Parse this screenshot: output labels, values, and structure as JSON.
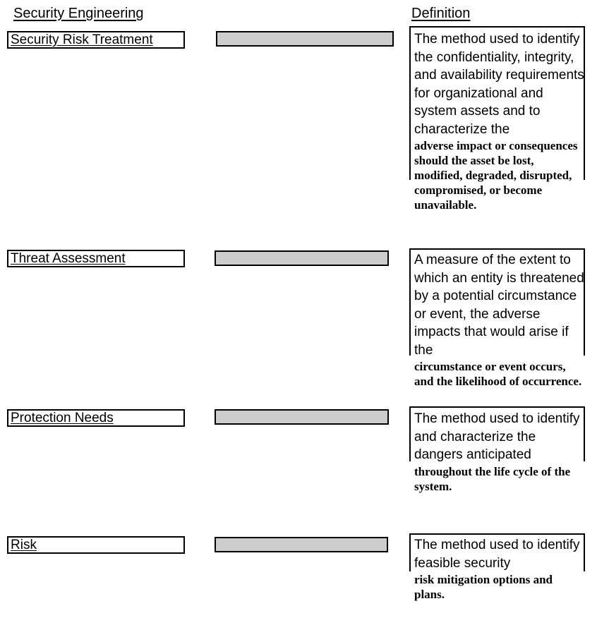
{
  "headers": {
    "left": "Security Engineering",
    "right": "Definition"
  },
  "rows": [
    {
      "term": "Security Risk Treatment",
      "definition_primary": "The method used to identify the confidentiality, integrity, and availability requirements for organizational and system assets and to characterize the",
      "definition_secondary": "adverse impact or consequences should the asset be lost, modified, degraded, disrupted, compromised, or become unavailable."
    },
    {
      "term": "Threat Assessment",
      "definition_primary": "A measure of the extent to which an entity is threatened by a potential circumstance or event, the adverse impacts that would arise if the",
      "definition_secondary": "circumstance or event occurs, and the likelihood of occurrence."
    },
    {
      "term": "Protection Needs",
      "definition_primary": "The method used to identify and characterize the dangers anticipated",
      "definition_secondary": "throughout the life cycle of the system."
    },
    {
      "term": "Risk",
      "definition_primary": "The method used to identify feasible security",
      "definition_secondary": "risk mitigation options and plans."
    }
  ],
  "connectors": [
    {
      "label": ""
    },
    {
      "label": ""
    },
    {
      "label": ""
    },
    {
      "label": ""
    }
  ],
  "colors": {
    "connector_fill": "#cccccc",
    "border": "#000000",
    "background": "#ffffff",
    "text": "#000000"
  }
}
